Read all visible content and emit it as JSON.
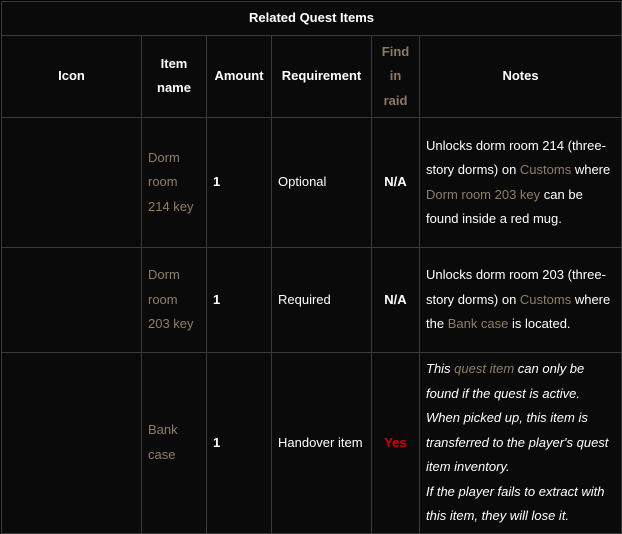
{
  "table": {
    "caption": "Related Quest Items",
    "headers": {
      "icon": "Icon",
      "item_name": "Item name",
      "amount": "Amount",
      "requirement": "Requirement",
      "find_in_raid": "Find in raid",
      "notes": "Notes"
    },
    "rows": [
      {
        "item_name": "Dorm room 214 key",
        "amount": "1",
        "requirement": "Optional",
        "fir": "N/A",
        "notes": {
          "p1": "Unlocks dorm room 214 (three-story dorms) on ",
          "link1": "Customs",
          "p2": " where ",
          "link2": "Dorm room 203 key",
          "p3": " can be found inside a red mug."
        }
      },
      {
        "item_name": "Dorm room 203 key",
        "amount": "1",
        "requirement": "Required",
        "fir": "N/A",
        "notes": {
          "p1": "Unlocks dorm room 203 (three-story dorms) on ",
          "link1": "Customs",
          "p2": " where the ",
          "link2": "Bank case",
          "p3": " is located."
        }
      },
      {
        "item_name": "Bank case",
        "amount": "1",
        "requirement": "Handover item",
        "fir": "Yes",
        "notes": {
          "p1": "This ",
          "link1": "quest item",
          "p2": " can only be found if the quest is active. When picked up, this item is transferred to the player's quest item inventory.",
          "p3": "If the player fails to extract with this item, they will lose it."
        }
      }
    ]
  },
  "colors": {
    "fir_yes": "#d90000",
    "link": "#8f7f67"
  }
}
